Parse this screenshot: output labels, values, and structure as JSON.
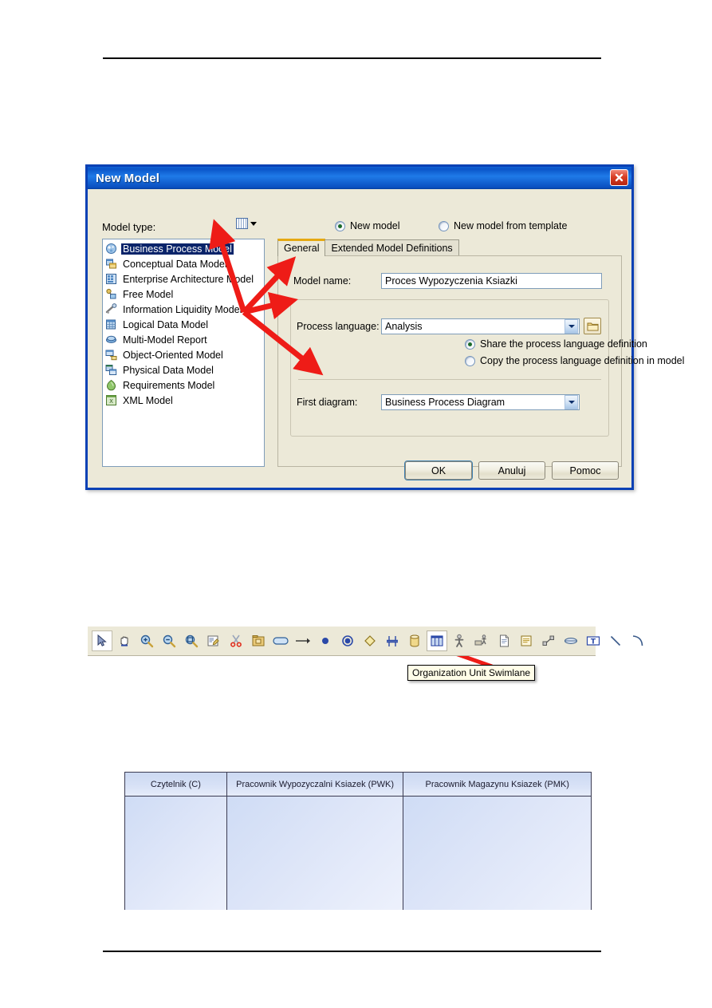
{
  "page": {
    "rules": [
      "header-rule",
      "footer-rule"
    ]
  },
  "dialog": {
    "title": "New Model",
    "close_icon": "close-icon",
    "model_type_label": "Model type:",
    "list_view_icon": "list-view-icon",
    "top_radios": [
      {
        "label": "New model",
        "checked": true
      },
      {
        "label": "New model from template",
        "checked": false
      }
    ],
    "model_types": [
      {
        "label": "Business Process Model",
        "icon": "business-process-model-icon",
        "selected": true
      },
      {
        "label": "Conceptual Data Model",
        "icon": "conceptual-data-model-icon",
        "selected": false
      },
      {
        "label": "Enterprise Architecture Model",
        "icon": "enterprise-architecture-model-icon",
        "selected": false
      },
      {
        "label": "Free Model",
        "icon": "free-model-icon",
        "selected": false
      },
      {
        "label": "Information Liquidity Model",
        "icon": "information-liquidity-model-icon",
        "selected": false
      },
      {
        "label": "Logical Data Model",
        "icon": "logical-data-model-icon",
        "selected": false
      },
      {
        "label": "Multi-Model Report",
        "icon": "multi-model-report-icon",
        "selected": false
      },
      {
        "label": "Object-Oriented Model",
        "icon": "object-oriented-model-icon",
        "selected": false
      },
      {
        "label": "Physical Data Model",
        "icon": "physical-data-model-icon",
        "selected": false
      },
      {
        "label": "Requirements Model",
        "icon": "requirements-model-icon",
        "selected": false
      },
      {
        "label": "XML Model",
        "icon": "xml-model-icon",
        "selected": false
      }
    ],
    "tabs": [
      {
        "label": "General",
        "active": true
      },
      {
        "label": "Extended Model Definitions",
        "active": false
      }
    ],
    "fields": {
      "model_name_label": "Model name:",
      "model_name_value": "Proces Wypozyczenia Ksiazki",
      "model_name_placeholder": "",
      "process_language_label": "Process language:",
      "process_language_value": "Analysis",
      "process_language_browse_icon": "folder-icon",
      "first_diagram_label": "First diagram:",
      "first_diagram_value": "Business Process Diagram"
    },
    "language_radios": [
      {
        "label": "Share the process language definition",
        "checked": true
      },
      {
        "label": "Copy the process language definition in model",
        "checked": false
      }
    ],
    "buttons": {
      "ok": "OK",
      "cancel": "Anuluj",
      "help": "Pomoc"
    }
  },
  "toolbar": {
    "items": [
      {
        "icon": "pointer-icon",
        "state": "pressed"
      },
      {
        "icon": "pan-hand-icon",
        "state": "normal"
      },
      {
        "icon": "zoom-in-icon",
        "state": "normal"
      },
      {
        "icon": "zoom-out-icon",
        "state": "normal"
      },
      {
        "icon": "zoom-fit-icon",
        "state": "normal"
      },
      {
        "icon": "properties-icon",
        "state": "normal"
      },
      {
        "icon": "scissors-icon",
        "state": "normal"
      },
      {
        "icon": "package-icon",
        "state": "normal"
      },
      {
        "icon": "process-rounded-icon",
        "state": "normal"
      },
      {
        "icon": "flow-arrow-icon",
        "state": "normal"
      },
      {
        "icon": "start-event-icon",
        "state": "normal"
      },
      {
        "icon": "end-event-icon",
        "state": "normal"
      },
      {
        "icon": "decision-diamond-icon",
        "state": "normal"
      },
      {
        "icon": "synchronization-bar-icon",
        "state": "normal"
      },
      {
        "icon": "resource-cylinder-icon",
        "state": "normal"
      },
      {
        "icon": "organization-unit-swimlane-icon",
        "state": "selected"
      },
      {
        "icon": "organization-unit-icon",
        "state": "normal"
      },
      {
        "icon": "role-association-icon",
        "state": "normal"
      },
      {
        "icon": "document-icon",
        "state": "normal"
      },
      {
        "icon": "note-icon",
        "state": "normal"
      },
      {
        "icon": "link-icon",
        "state": "normal"
      },
      {
        "icon": "data-store-icon",
        "state": "normal"
      },
      {
        "icon": "text-box-icon",
        "state": "normal"
      },
      {
        "icon": "line-icon",
        "state": "normal"
      },
      {
        "icon": "arc-icon",
        "state": "normal"
      }
    ],
    "tooltip": "Organization Unit Swimlane"
  },
  "swimlane": {
    "lanes": [
      {
        "title": "Czytelnik (C)"
      },
      {
        "title": "Pracownik Wypozyczalni Ksiazek (PWK)"
      },
      {
        "title": "Pracownik Magazynu Ksiazek (PMK)"
      }
    ]
  },
  "colors": {
    "titlebar_blue": "#1f7ae8",
    "dialog_face": "#ece9d8",
    "selection_blue": "#0a246a",
    "annotation_red": "#ee1c17",
    "lane_header": "#d3dff4",
    "lane_body": "#dde5f8",
    "tab_accent": "#e5a912"
  }
}
